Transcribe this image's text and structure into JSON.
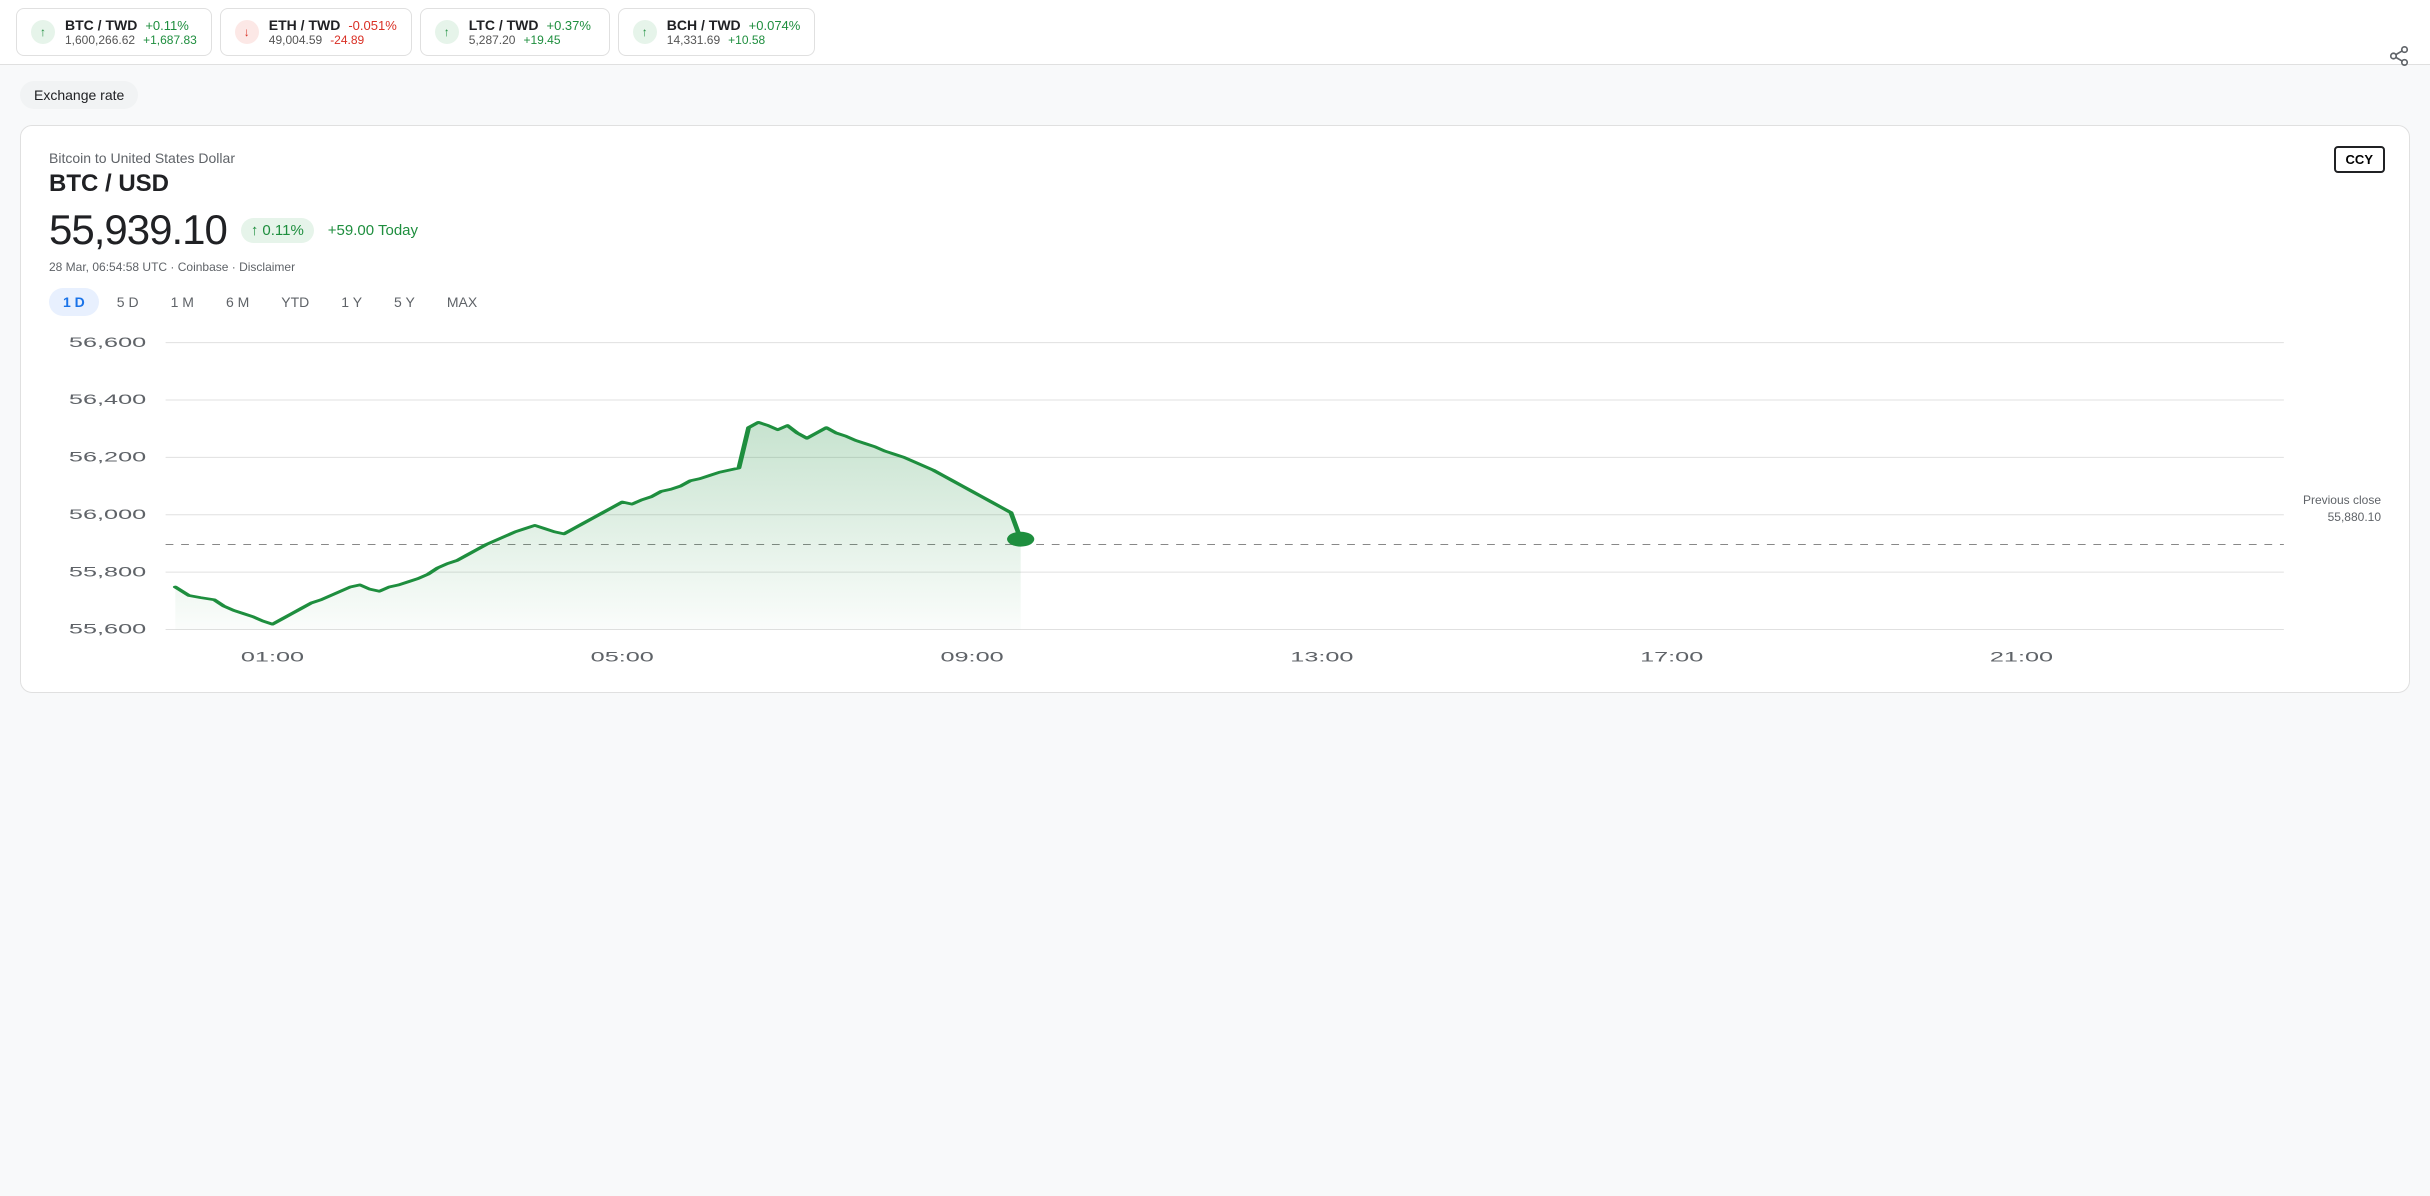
{
  "tickers": [
    {
      "pair": "BTC / TWD",
      "direction": "up",
      "change_pct": "+0.11%",
      "price": "1,600,266.62",
      "change_abs": "+1,687.83"
    },
    {
      "pair": "ETH / TWD",
      "direction": "down",
      "change_pct": "-0.051%",
      "price": "49,004.59",
      "change_abs": "-24.89"
    },
    {
      "pair": "LTC / TWD",
      "direction": "up",
      "change_pct": "+0.37%",
      "price": "5,287.20",
      "change_abs": "+19.45"
    },
    {
      "pair": "BCH / TWD",
      "direction": "up",
      "change_pct": "+0.074%",
      "price": "14,331.69",
      "change_abs": "+10.58"
    }
  ],
  "exchange_rate_label": "Exchange rate",
  "share_icon": "⋯",
  "chart": {
    "subtitle": "Bitcoin to United States Dollar",
    "title": "BTC / USD",
    "price": "55,939.10",
    "change_pct": "0.11%",
    "change_today": "+59.00 Today",
    "data_source": "28 Mar, 06:54:58 UTC · Coinbase · Disclaimer",
    "ccy_label": "CCY",
    "previous_close_label": "Previous close",
    "previous_close_value": "55,880.10",
    "y_labels": [
      "56,600",
      "56,400",
      "56,200",
      "56,000",
      "55,800",
      "55,600"
    ],
    "x_labels": [
      "01:00",
      "05:00",
      "09:00",
      "13:00",
      "17:00",
      "21:00"
    ],
    "time_tabs": [
      "1 D",
      "5 D",
      "1 M",
      "6 M",
      "YTD",
      "1 Y",
      "5 Y",
      "MAX"
    ],
    "active_tab": "1 D"
  }
}
